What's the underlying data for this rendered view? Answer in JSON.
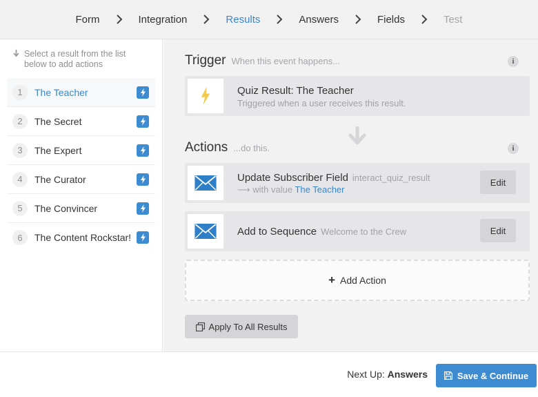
{
  "breadcrumbs": [
    {
      "label": "Form",
      "state": "normal"
    },
    {
      "label": "Integration",
      "state": "normal"
    },
    {
      "label": "Results",
      "state": "active"
    },
    {
      "label": "Answers",
      "state": "normal"
    },
    {
      "label": "Fields",
      "state": "normal"
    },
    {
      "label": "Test",
      "state": "disabled"
    }
  ],
  "sidebar": {
    "hint": "Select a result from the list below to add actions",
    "results": [
      {
        "num": "1",
        "name": "The Teacher",
        "selected": true
      },
      {
        "num": "2",
        "name": "The Secret",
        "selected": false
      },
      {
        "num": "3",
        "name": "The Expert",
        "selected": false
      },
      {
        "num": "4",
        "name": "The Curator",
        "selected": false
      },
      {
        "num": "5",
        "name": "The Convincer",
        "selected": false
      },
      {
        "num": "6",
        "name": "The Content Rockstar!",
        "selected": false
      }
    ]
  },
  "trigger": {
    "title": "Trigger",
    "subtitle": "When this event happens...",
    "card_title": "Quiz Result: The Teacher",
    "card_sub": "Triggered when a user receives this result."
  },
  "actions": {
    "title": "Actions",
    "subtitle": "...do this.",
    "items": [
      {
        "title": "Update Subscriber Field",
        "detail": "interact_quiz_result",
        "value_prefix": "with value",
        "value": "The Teacher",
        "edit_label": "Edit"
      },
      {
        "title": "Add to Sequence",
        "detail": "Welcome to the Crew",
        "edit_label": "Edit"
      }
    ],
    "add_label": "Add Action",
    "apply_label": "Apply To All Results"
  },
  "footer": {
    "next_prefix": "Next Up:",
    "next_step": "Answers",
    "save_label": "Save & Continue"
  },
  "colors": {
    "accent": "#3d8bd0",
    "bolt": "#f2c94c",
    "envelope": "#2f7fc8"
  }
}
